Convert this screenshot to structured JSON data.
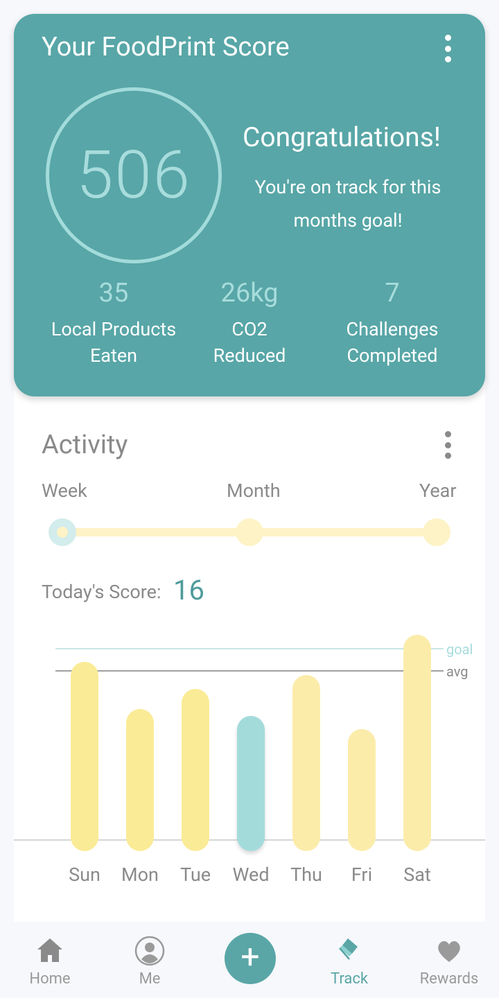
{
  "score_card": {
    "title": "Your FoodPrint Score",
    "score": "506",
    "headline": "Congratulations!",
    "message": "You're on track for this months goal!",
    "stats": [
      {
        "value": "35",
        "label_line1": "Local Products",
        "label_line2": "Eaten"
      },
      {
        "value": "26kg",
        "label_line1": "CO2",
        "label_line2": "Reduced"
      },
      {
        "value": "7",
        "label_line1": "Challenges",
        "label_line2": "Completed"
      }
    ]
  },
  "activity": {
    "title": "Activity",
    "periods": [
      "Week",
      "Month",
      "Year"
    ],
    "selected_period": "Week",
    "today_label": "Today's Score:",
    "today_value": "16",
    "goal_label": "goal",
    "avg_label": "avg",
    "selected_day": "Wed"
  },
  "chart_data": {
    "type": "bar",
    "categories": [
      "Sun",
      "Mon",
      "Tue",
      "Wed",
      "Thu",
      "Fri",
      "Sat"
    ],
    "values": [
      28,
      21,
      24,
      20,
      26,
      18,
      32
    ],
    "goal": 29,
    "avg": 26,
    "ylim": [
      0,
      33
    ]
  },
  "nav": {
    "items": [
      {
        "label": "Home",
        "icon": "home-icon"
      },
      {
        "label": "Me",
        "icon": "user-icon"
      },
      {
        "label": "",
        "icon": "plus-icon"
      },
      {
        "label": "Track",
        "icon": "eraser-icon"
      },
      {
        "label": "Rewards",
        "icon": "heart-icon"
      }
    ],
    "active": "Track"
  },
  "colors": {
    "card": "#58a6a7",
    "accent_light": "#a8dcdc",
    "bar_past": "#faeb96",
    "bar_future": "#fcecaa",
    "bar_selected": "#a3dbdb"
  }
}
